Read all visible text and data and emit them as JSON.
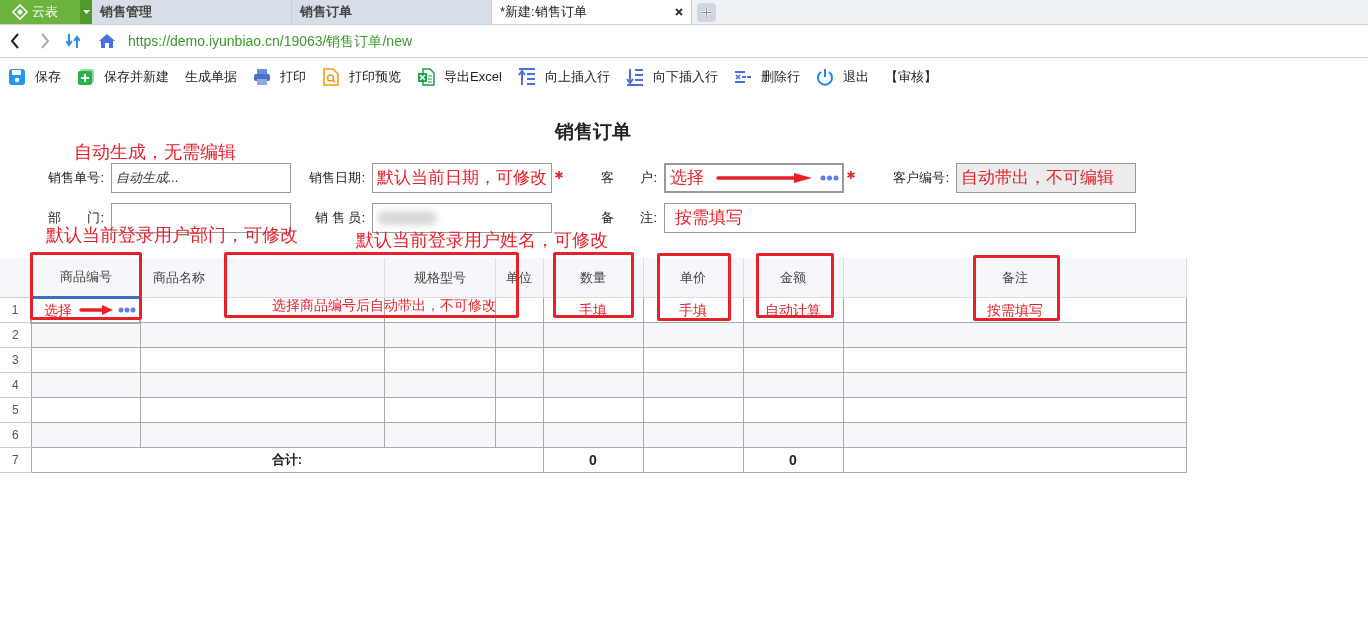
{
  "app": {
    "name": "云表"
  },
  "tabs": [
    {
      "label": "销售管理",
      "selected": false
    },
    {
      "label": "销售订单",
      "selected": false
    },
    {
      "label": "*新建:销售订单",
      "selected": true
    }
  ],
  "address": {
    "url": "https://demo.iyunbiao.cn/19063/销售订单/new"
  },
  "toolbar": [
    {
      "label": "保存",
      "kind": "save"
    },
    {
      "label": "保存并新建",
      "kind": "savenew"
    },
    {
      "label": "生成单据",
      "kind": "plain"
    },
    {
      "label": "打印",
      "kind": "print"
    },
    {
      "label": "打印预览",
      "kind": "preview"
    },
    {
      "label": "导出Excel",
      "kind": "export"
    },
    {
      "label": "向上插入行",
      "kind": "insertup"
    },
    {
      "label": "向下插入行",
      "kind": "insertdown"
    },
    {
      "label": "删除行",
      "kind": "deleterow"
    },
    {
      "label": "退出",
      "kind": "exit"
    },
    {
      "label": "【审核】",
      "kind": "plain"
    }
  ],
  "title": "销售订单",
  "form": [
    [
      {
        "label": "销售单号:",
        "placeholder": "自动生成...",
        "kind": "text",
        "required": false
      },
      {
        "label": "销售日期:",
        "value": "默认当前日期，可修改",
        "kind": "text",
        "required": true
      },
      {
        "label": "客　　户:",
        "value": "选择",
        "kind": "picker",
        "required": true
      },
      {
        "label": "客户编号:",
        "value": "自动带出，不可编辑",
        "kind": "readonly",
        "required": false
      }
    ],
    [
      {
        "label": "部　　门:",
        "kind": "text",
        "required": false
      },
      {
        "label": "销 售 员:",
        "kind": "redacted",
        "required": false
      },
      {
        "label": "备　　注:",
        "value": "按需填写",
        "kind": "wide",
        "required": false
      }
    ]
  ],
  "annotations": [
    "自动生成，无需编辑",
    "默认当前登录用户部门，可修改",
    "默认当前登录用户姓名，可修改",
    "选择商品编号后自动带出，不可修改"
  ],
  "grid": {
    "columns": [
      {
        "label": "商品编号",
        "selected": true
      },
      {
        "label": "商品名称",
        "selected": false
      },
      {
        "label": "规格型号",
        "selected": false
      },
      {
        "label": "单位",
        "selected": false
      },
      {
        "label": "数量",
        "selected": false
      },
      {
        "label": "单价",
        "selected": false
      },
      {
        "label": "金额",
        "selected": false
      },
      {
        "label": "备注",
        "selected": false
      }
    ],
    "rows": [
      {
        "number": "1",
        "cells": [
          "选择",
          "",
          "",
          "",
          "手填",
          "手填",
          "自动计算",
          "按需填写"
        ]
      },
      {
        "number": "2",
        "cells": [
          "",
          "",
          "",
          "",
          "",
          "",
          "",
          ""
        ]
      },
      {
        "number": "3",
        "cells": [
          "",
          "",
          "",
          "",
          "",
          "",
          "",
          ""
        ]
      },
      {
        "number": "4",
        "cells": [
          "",
          "",
          "",
          "",
          "",
          "",
          "",
          ""
        ]
      },
      {
        "number": "5",
        "cells": [
          "",
          "",
          "",
          "",
          "",
          "",
          "",
          ""
        ]
      },
      {
        "number": "6",
        "cells": [
          "",
          "",
          "",
          "",
          "",
          "",
          "",
          ""
        ]
      }
    ],
    "total": {
      "number": "7",
      "label": "合计:",
      "quantity": "0",
      "amount": "0"
    }
  }
}
